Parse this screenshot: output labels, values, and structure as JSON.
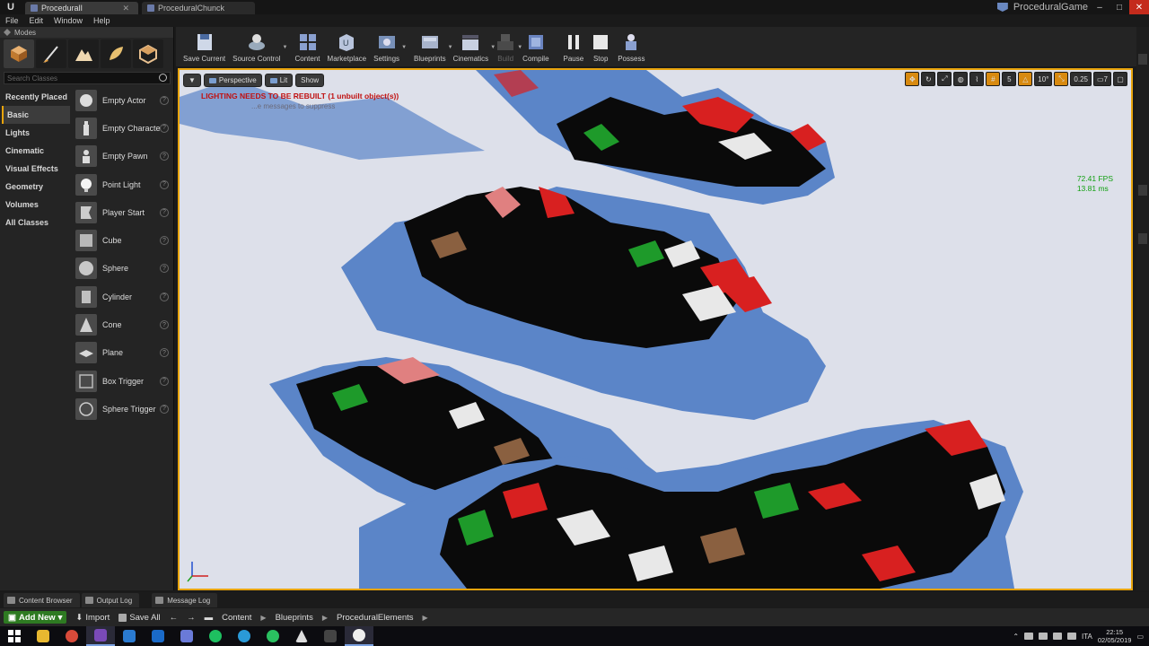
{
  "window": {
    "tabs": [
      "ProceduralI",
      "ProceduralChunck"
    ],
    "project_name": "ProceduralGame",
    "controls": [
      "–",
      "□",
      "✕"
    ]
  },
  "menu": [
    "File",
    "Edit",
    "Window",
    "Help"
  ],
  "modes_panel": {
    "title": "Modes",
    "search_placeholder": "Search Classes",
    "categories": [
      "Recently Placed",
      "Basic",
      "Lights",
      "Cinematic",
      "Visual Effects",
      "Geometry",
      "Volumes",
      "All Classes"
    ],
    "selected_category": "Basic",
    "items": [
      "Empty Actor",
      "Empty Characte",
      "Empty Pawn",
      "Point Light",
      "Player Start",
      "Cube",
      "Sphere",
      "Cylinder",
      "Cone",
      "Plane",
      "Box Trigger",
      "Sphere Trigger"
    ]
  },
  "toolbar": {
    "buttons": [
      "Save Current",
      "Source Control",
      "Content",
      "Marketplace",
      "Settings",
      "Blueprints",
      "Cinematics",
      "Build",
      "Compile",
      "Pause",
      "Stop",
      "Possess"
    ]
  },
  "viewport": {
    "perspective": "Perspective",
    "lit": "Lit",
    "show": "Show",
    "warning": "LIGHTING NEEDS TO BE REBUILT (1 unbuilt object(s))",
    "warning_sub": "...e messages to suppress",
    "fps": "72.41 FPS",
    "ms": "13.81 ms",
    "grid_snap": "5",
    "rot_snap": "10°",
    "scale_snap": "0.25",
    "camera_speed": "7"
  },
  "bottom_tabs": [
    "Content Browser",
    "Output Log",
    "Message Log"
  ],
  "content_browser": {
    "add_new": "Add New",
    "import": "Import",
    "save_all": "Save All",
    "path": [
      "Content",
      "Blueprints",
      "ProceduralElements"
    ]
  },
  "taskbar": {
    "lang": "ITA",
    "time": "22:15",
    "date": "02/05/2019"
  },
  "colors": {
    "accent": "#e8a40c",
    "warning": "#c01010",
    "fps": "#12a012",
    "terrain_blue": "#5b85c8",
    "terrain_red": "#d82020",
    "terrain_green": "#1e9a2a",
    "terrain_brown": "#8a6040"
  }
}
